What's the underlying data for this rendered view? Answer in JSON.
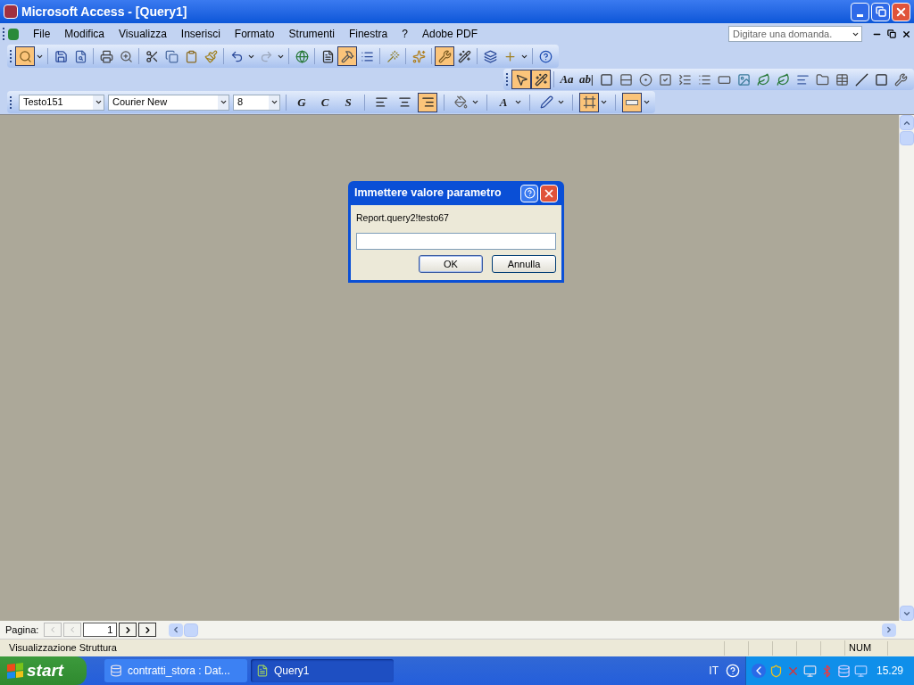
{
  "window": {
    "title": "Microsoft Access - [Query1]"
  },
  "menu": {
    "items": [
      "File",
      "Modifica",
      "Visualizza",
      "Inserisci",
      "Formato",
      "Strumenti",
      "Finestra",
      "?",
      "Adobe PDF"
    ],
    "help_search": {
      "placeholder": "Digitare una domanda."
    }
  },
  "toolbar": [
    {
      "kind": "preview",
      "pressed": true,
      "menu": true
    },
    {
      "kind": "sep"
    },
    {
      "kind": "save",
      "pressed": false,
      "menu": false
    },
    {
      "kind": "filesearch",
      "pressed": false,
      "menu": false
    },
    {
      "kind": "sep"
    },
    {
      "kind": "print",
      "pressed": false,
      "menu": false
    },
    {
      "kind": "zoom",
      "pressed": false,
      "menu": false
    },
    {
      "kind": "sep"
    },
    {
      "kind": "cut",
      "pressed": false,
      "menu": false
    },
    {
      "kind": "copy",
      "pressed": false,
      "menu": false
    },
    {
      "kind": "paste",
      "pressed": false,
      "menu": false
    },
    {
      "kind": "brush",
      "pressed": false,
      "menu": false
    },
    {
      "kind": "sep"
    },
    {
      "kind": "undo",
      "pressed": false,
      "menu": true
    },
    {
      "kind": "redo",
      "pressed": false,
      "menu": true
    },
    {
      "kind": "sep"
    },
    {
      "kind": "globe",
      "pressed": false,
      "menu": false
    },
    {
      "kind": "sep"
    },
    {
      "kind": "doc",
      "pressed": false,
      "menu": false
    },
    {
      "kind": "hammer",
      "pressed": true,
      "menu": false
    },
    {
      "kind": "list",
      "pressed": false,
      "menu": false
    },
    {
      "kind": "sep"
    },
    {
      "kind": "wand",
      "pressed": false,
      "menu": false
    },
    {
      "kind": "sep"
    },
    {
      "kind": "sparkle",
      "pressed": false,
      "menu": false
    },
    {
      "kind": "sep"
    },
    {
      "kind": "toolbox",
      "pressed": true,
      "menu": false
    },
    {
      "kind": "magic",
      "pressed": false,
      "menu": false
    },
    {
      "kind": "sep"
    },
    {
      "kind": "windows",
      "pressed": false,
      "menu": false
    },
    {
      "kind": "newobject",
      "pressed": false,
      "menu": true
    },
    {
      "kind": "sep"
    },
    {
      "kind": "help",
      "pressed": false,
      "menu": false
    }
  ],
  "toolbox": [
    {
      "kind": "pointer",
      "pressed": true
    },
    {
      "kind": "magic",
      "pressed": true
    },
    {
      "kind": "sep"
    },
    {
      "kind": "label",
      "text": "Aa",
      "pressed": false
    },
    {
      "kind": "label",
      "text": "ab|",
      "pressed": false
    },
    {
      "kind": "frame",
      "pressed": false
    },
    {
      "kind": "toggle",
      "pressed": false
    },
    {
      "kind": "radio",
      "pressed": false
    },
    {
      "kind": "check",
      "pressed": false
    },
    {
      "kind": "combo",
      "pressed": false
    },
    {
      "kind": "listbox",
      "pressed": false
    },
    {
      "kind": "button",
      "pressed": false
    },
    {
      "kind": "image",
      "pressed": false
    },
    {
      "kind": "object",
      "pressed": false
    },
    {
      "kind": "object",
      "pressed": false
    },
    {
      "kind": "pagebreak",
      "pressed": false
    },
    {
      "kind": "tab",
      "pressed": false
    },
    {
      "kind": "subform",
      "pressed": false
    },
    {
      "kind": "line",
      "pressed": false
    },
    {
      "kind": "rect",
      "pressed": false
    },
    {
      "kind": "wrench",
      "pressed": false
    }
  ],
  "format_bar": {
    "object": "Testo151",
    "font": "Courier New",
    "size": "8",
    "buttons": [
      {
        "kind": "label",
        "text": "G",
        "pressed": false,
        "menu": false
      },
      {
        "kind": "label",
        "text": "C",
        "pressed": false,
        "menu": false
      },
      {
        "kind": "label",
        "text": "S",
        "pressed": false,
        "menu": false
      },
      {
        "kind": "sep"
      },
      {
        "kind": "alignleft",
        "pressed": false,
        "menu": false
      },
      {
        "kind": "aligncenter",
        "pressed": false,
        "menu": false
      },
      {
        "kind": "alignright",
        "pressed": true,
        "menu": false
      },
      {
        "kind": "sep"
      },
      {
        "kind": "bucket",
        "pressed": false,
        "menu": true
      },
      {
        "kind": "sep"
      },
      {
        "kind": "label",
        "text": "A",
        "pressed": false,
        "menu": true
      },
      {
        "kind": "sep"
      },
      {
        "kind": "pen",
        "pressed": false,
        "menu": true
      },
      {
        "kind": "sep"
      },
      {
        "kind": "border",
        "pressed": true,
        "menu": true
      },
      {
        "kind": "sep"
      },
      {
        "kind": "special",
        "pressed": true,
        "menu": true
      }
    ]
  },
  "dialog": {
    "title": "Immettere valore parametro",
    "prompt": "Report.query2!testo67",
    "buttons": [
      "OK",
      "Annulla"
    ]
  },
  "navigation": {
    "label": "Pagina:",
    "page": "1"
  },
  "status_bar": {
    "text": "Visualizzazione Struttura",
    "indicator": "NUM"
  },
  "taskbar": {
    "start": "start",
    "tasks": [
      {
        "label": "contratti_stora : Dat...",
        "selected": false
      },
      {
        "label": "Query1",
        "selected": true
      }
    ],
    "language": "IT",
    "clock": "15.29"
  }
}
